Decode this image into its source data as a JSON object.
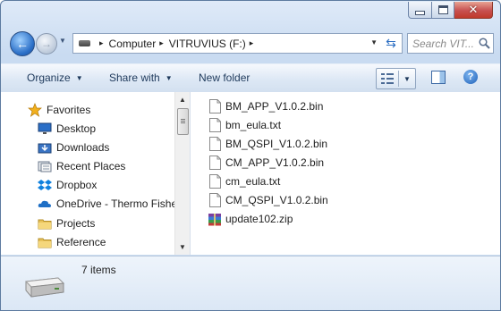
{
  "window": {
    "close_glyph": "✕"
  },
  "address": {
    "crumbs": [
      "Computer",
      "VITRUVIUS (F:)"
    ],
    "separator": "▸"
  },
  "search": {
    "placeholder": "Search VIT..."
  },
  "toolbar": {
    "organize": "Organize",
    "share_with": "Share with",
    "new_folder": "New folder",
    "help": "?"
  },
  "sidebar": {
    "favorites_label": "Favorites",
    "items": [
      {
        "label": "Favorites",
        "icon": "star-icon"
      },
      {
        "label": "Desktop",
        "icon": "desktop-icon"
      },
      {
        "label": "Downloads",
        "icon": "downloads-icon"
      },
      {
        "label": "Recent Places",
        "icon": "recent-places-icon"
      },
      {
        "label": "Dropbox",
        "icon": "dropbox-icon"
      },
      {
        "label": "OneDrive - Thermo Fisher",
        "icon": "onedrive-icon"
      },
      {
        "label": "Projects",
        "icon": "folder-icon"
      },
      {
        "label": "Reference",
        "icon": "folder-icon"
      }
    ]
  },
  "files": [
    {
      "name": "BM_APP_V1.0.2.bin",
      "icon": "document-icon"
    },
    {
      "name": "bm_eula.txt",
      "icon": "document-icon"
    },
    {
      "name": "BM_QSPI_V1.0.2.bin",
      "icon": "document-icon"
    },
    {
      "name": "CM_APP_V1.0.2.bin",
      "icon": "document-icon"
    },
    {
      "name": "cm_eula.txt",
      "icon": "document-icon"
    },
    {
      "name": "CM_QSPI_V1.0.2.bin",
      "icon": "document-icon"
    },
    {
      "name": "update102.zip",
      "icon": "zip-archive-icon"
    }
  ],
  "status": {
    "item_count": "7 items"
  },
  "colors": {
    "window_frame": "#c9dbf1",
    "command_text": "#1e395b",
    "favorites_star": "#f2b01e"
  }
}
